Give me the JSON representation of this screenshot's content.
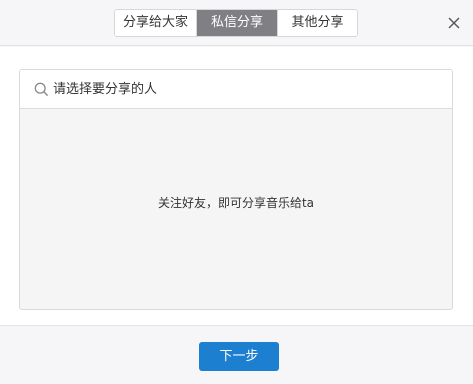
{
  "tabs": [
    {
      "label": "分享给大家",
      "active": false
    },
    {
      "label": "私信分享",
      "active": true
    },
    {
      "label": "其他分享",
      "active": false
    }
  ],
  "search": {
    "placeholder": "请选择要分享的人",
    "value": ""
  },
  "empty_message": "关注好友，即可分享音乐给ta",
  "footer": {
    "next_label": "下一步"
  },
  "icons": {
    "close": "close-icon",
    "search": "search-icon"
  },
  "colors": {
    "active_tab_bg": "#808084",
    "primary_button": "#1c7fd0"
  }
}
